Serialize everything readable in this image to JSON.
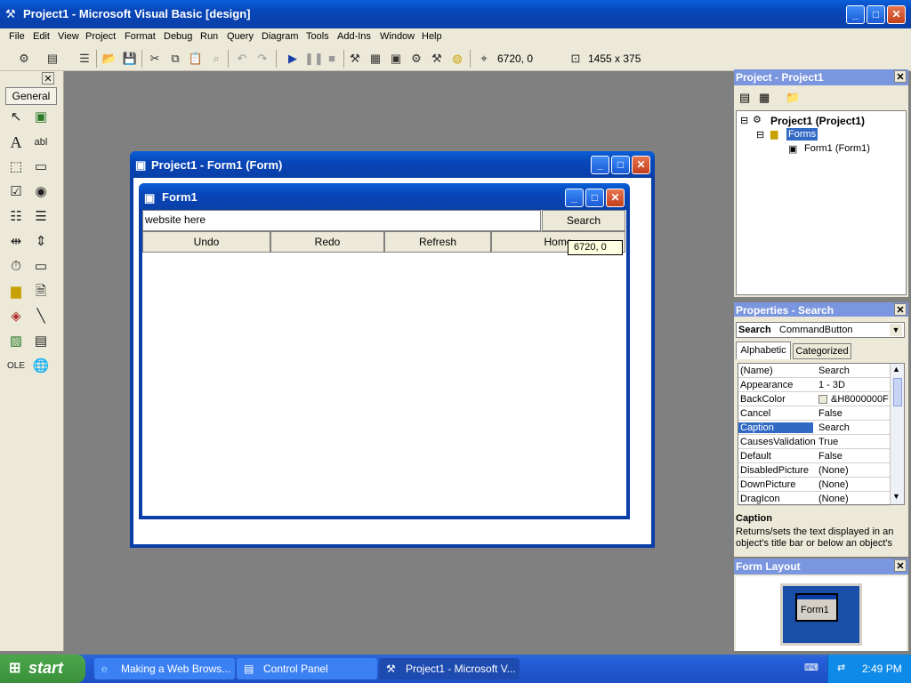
{
  "window": {
    "title": "Project1 - Microsoft Visual Basic [design]"
  },
  "menu": [
    "File",
    "Edit",
    "View",
    "Project",
    "Format",
    "Debug",
    "Run",
    "Query",
    "Diagram",
    "Tools",
    "Add-Ins",
    "Window",
    "Help"
  ],
  "toolbar": {
    "position": "6720, 0",
    "size": "1455 x 375"
  },
  "toolbox": {
    "tab": "General"
  },
  "form_designer": {
    "title": "Project1 - Form1 (Form)"
  },
  "form1": {
    "title": "Form1",
    "textbox_value": "website here",
    "search_label": "Search",
    "buttons": [
      "Undo",
      "Redo",
      "Refresh",
      "Home"
    ],
    "tooltip": "6720, 0"
  },
  "project_panel": {
    "title": "Project - Project1",
    "root": "Project1 (Project1)",
    "folder": "Forms",
    "item": "Form1 (Form1)"
  },
  "properties_panel": {
    "title": "Properties - Search",
    "object_name": "Search",
    "object_type": "CommandButton",
    "tab_alpha": "Alphabetic",
    "tab_cat": "Categorized",
    "rows": [
      {
        "name": "(Name)",
        "value": "Search"
      },
      {
        "name": "Appearance",
        "value": "1 - 3D"
      },
      {
        "name": "BackColor",
        "value": "&H8000000F"
      },
      {
        "name": "Cancel",
        "value": "False"
      },
      {
        "name": "Caption",
        "value": "Search"
      },
      {
        "name": "CausesValidation",
        "value": "True"
      },
      {
        "name": "Default",
        "value": "False"
      },
      {
        "name": "DisabledPicture",
        "value": "(None)"
      },
      {
        "name": "DownPicture",
        "value": "(None)"
      },
      {
        "name": "DragIcon",
        "value": "(None)"
      }
    ],
    "desc_title": "Caption",
    "desc_text": "Returns/sets the text displayed in an object's title bar or below an object's"
  },
  "layout_panel": {
    "title": "Form Layout",
    "form_label": "Form1"
  },
  "taskbar": {
    "start": "start",
    "tasks": [
      "Making a Web Brows...",
      "Control Panel",
      "Project1 - Microsoft V..."
    ],
    "clock": "2:49 PM"
  }
}
